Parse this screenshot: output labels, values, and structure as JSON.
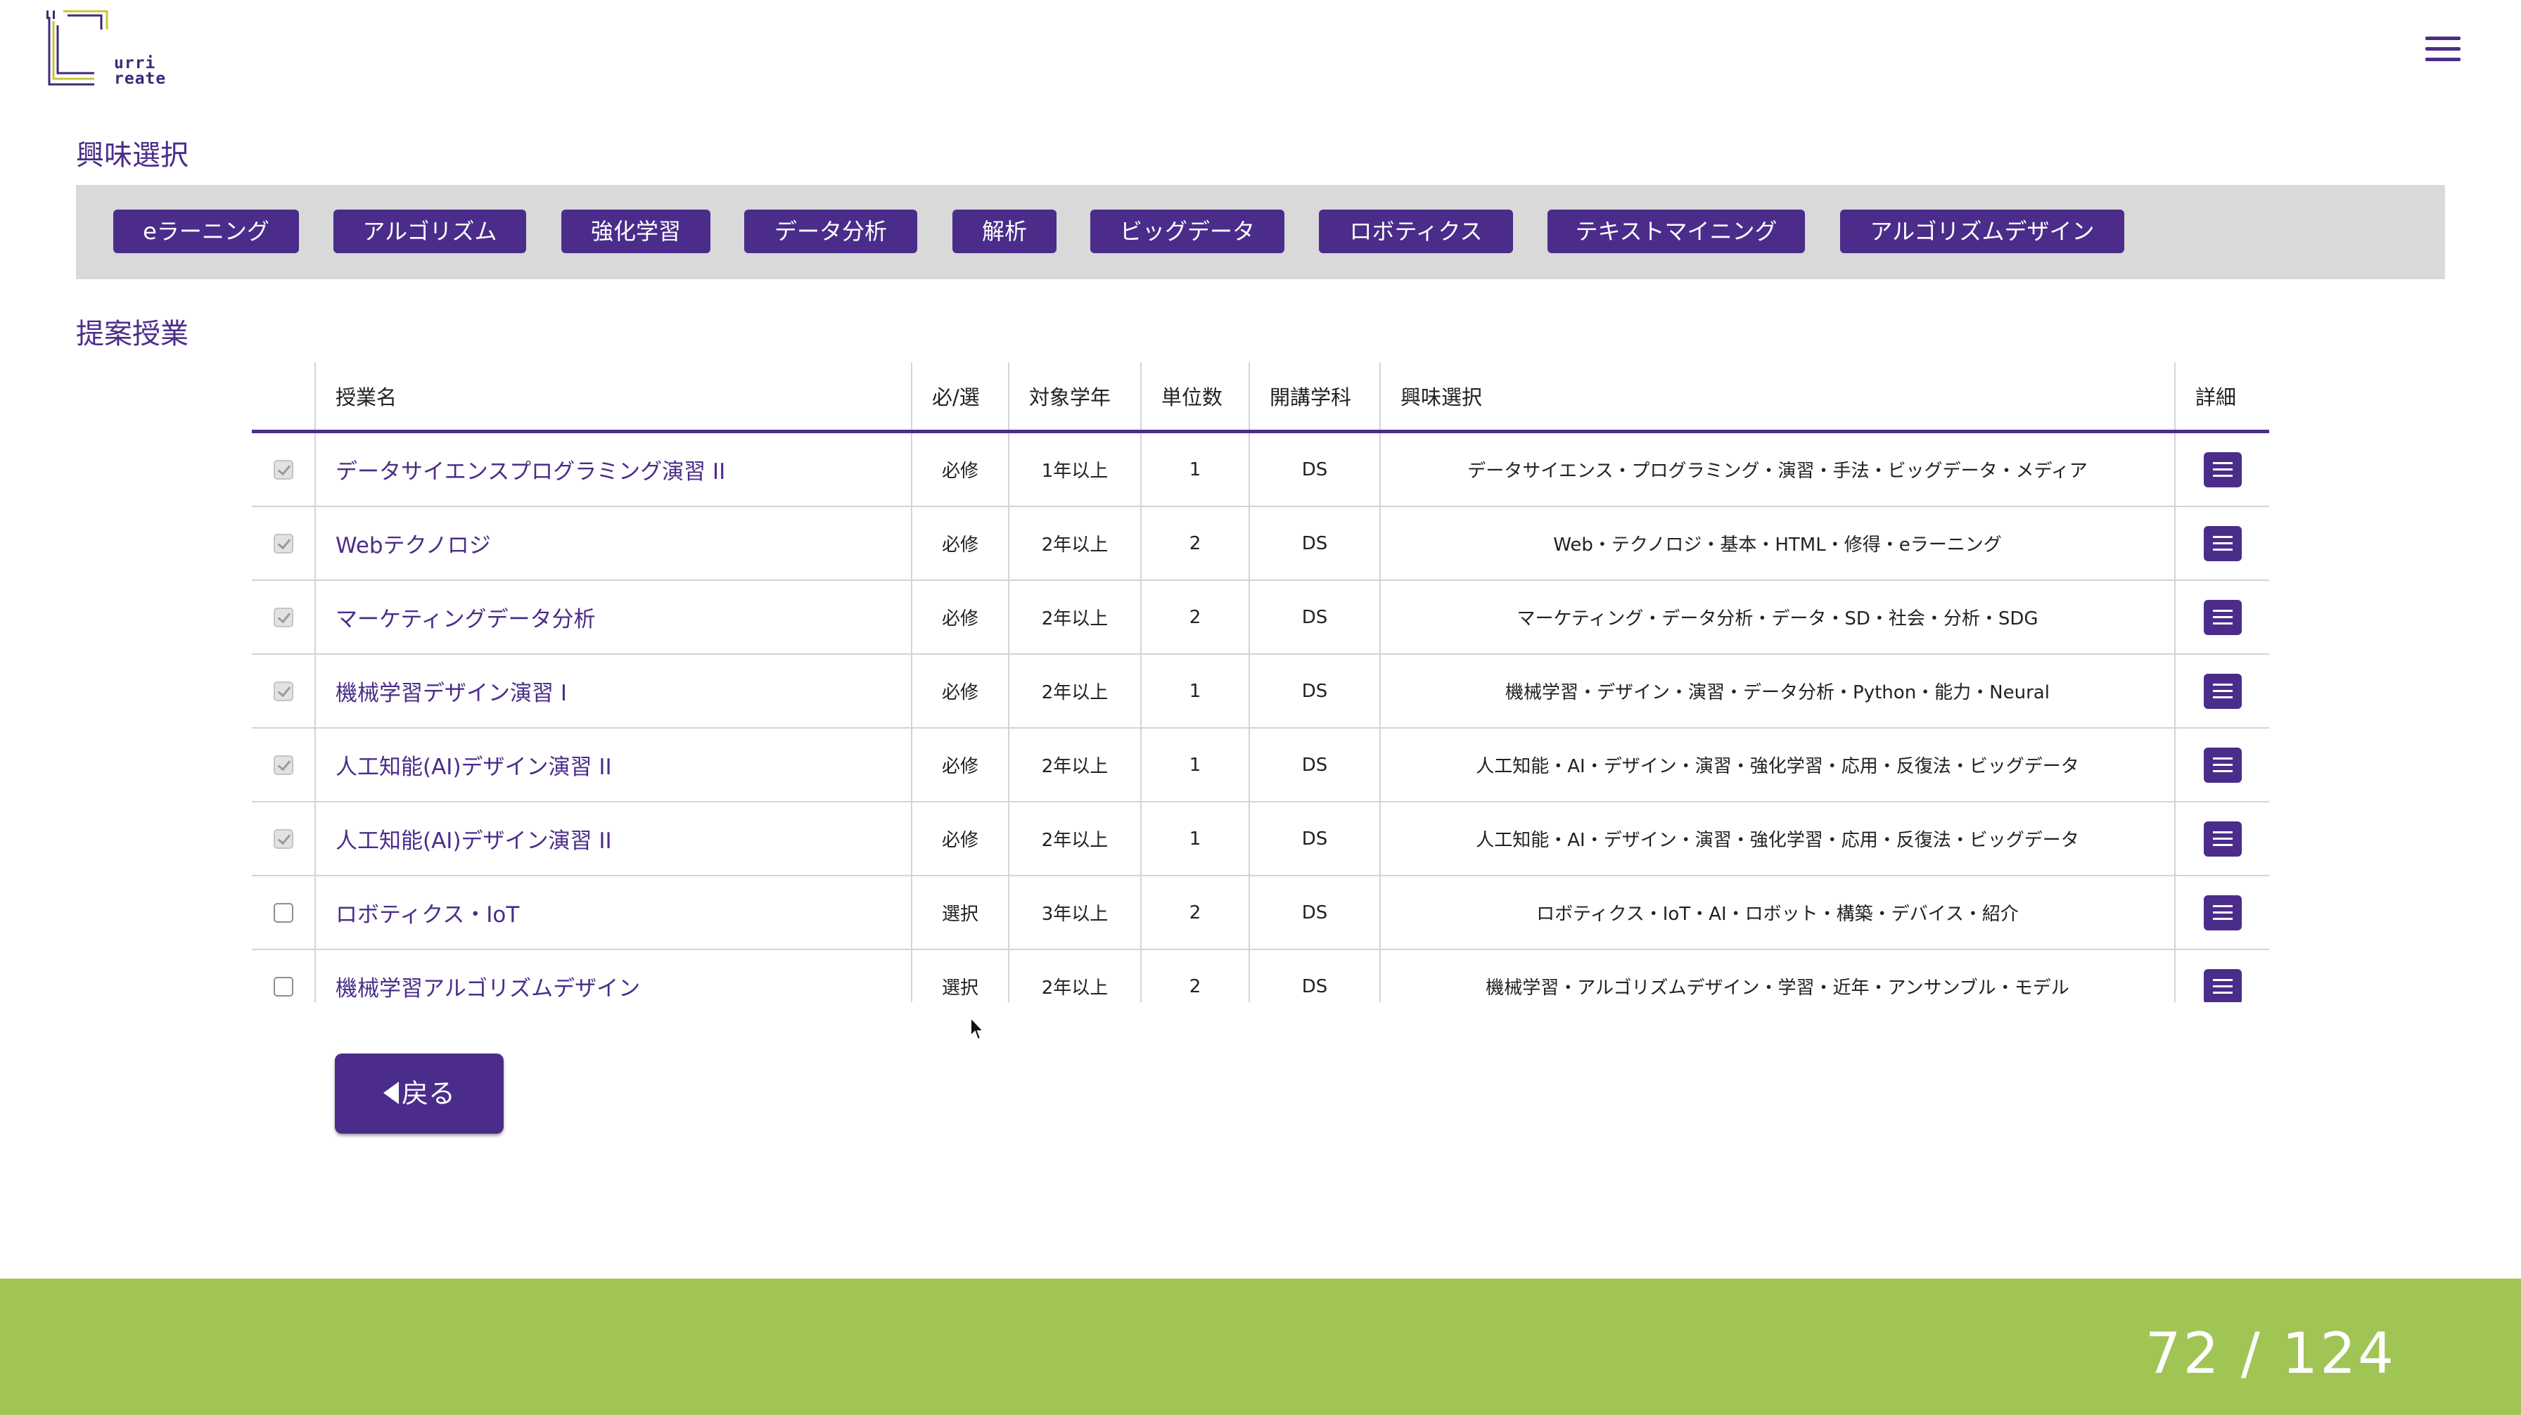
{
  "logo": {
    "line1": "urri",
    "line2": "reate"
  },
  "interest": {
    "title": "興味選択",
    "chips": [
      "eラーニング",
      "アルゴリズム",
      "強化学習",
      "データ分析",
      "解析",
      "ビッグデータ",
      "ロボティクス",
      "テキストマイニング",
      "アルゴリズムデザイン"
    ]
  },
  "courses": {
    "title": "提案授業",
    "headers": {
      "name": "授業名",
      "req": "必/選",
      "year": "対象学年",
      "credits": "単位数",
      "dept": "開講学科",
      "interest": "興味選択",
      "detail": "詳細"
    },
    "rows": [
      {
        "checked": true,
        "name": "データサイエンスプログラミング演習 II",
        "req": "必修",
        "year": "1年以上",
        "credits": "1",
        "dept": "DS",
        "tags": "データサイエンス・プログラミング・演習・手法・ビッグデータ・メディア"
      },
      {
        "checked": true,
        "name": "Webテクノロジ",
        "req": "必修",
        "year": "2年以上",
        "credits": "2",
        "dept": "DS",
        "tags": "Web・テクノロジ・基本・HTML・修得・eラーニング"
      },
      {
        "checked": true,
        "name": "マーケティングデータ分析",
        "req": "必修",
        "year": "2年以上",
        "credits": "2",
        "dept": "DS",
        "tags": "マーケティング・データ分析・データ・SD・社会・分析・SDG"
      },
      {
        "checked": true,
        "name": "機械学習デザイン演習 I",
        "req": "必修",
        "year": "2年以上",
        "credits": "1",
        "dept": "DS",
        "tags": "機械学習・デザイン・演習・データ分析・Python・能力・Neural"
      },
      {
        "checked": true,
        "name": "人工知能(AI)デザイン演習 II",
        "req": "必修",
        "year": "2年以上",
        "credits": "1",
        "dept": "DS",
        "tags": "人工知能・AI・デザイン・演習・強化学習・応用・反復法・ビッグデータ"
      },
      {
        "checked": true,
        "name": "人工知能(AI)デザイン演習 II",
        "req": "必修",
        "year": "2年以上",
        "credits": "1",
        "dept": "DS",
        "tags": "人工知能・AI・デザイン・演習・強化学習・応用・反復法・ビッグデータ"
      },
      {
        "checked": false,
        "name": "ロボティクス・IoT",
        "req": "選択",
        "year": "3年以上",
        "credits": "2",
        "dept": "DS",
        "tags": "ロボティクス・IoT・AI・ロボット・構築・デバイス・紹介"
      },
      {
        "checked": false,
        "name": "機械学習アルゴリズムデザイン",
        "req": "選択",
        "year": "2年以上",
        "credits": "2",
        "dept": "DS",
        "tags": "機械学習・アルゴリズムデザイン・学習・近年・アンサンブル・モデル"
      }
    ]
  },
  "back_button": {
    "label": "戻る"
  },
  "footer": {
    "page_indicator": "72 / 124"
  },
  "colors": {
    "accent": "#4b2c8a",
    "footer": "#a0c555",
    "band": "#d9d9d9"
  }
}
